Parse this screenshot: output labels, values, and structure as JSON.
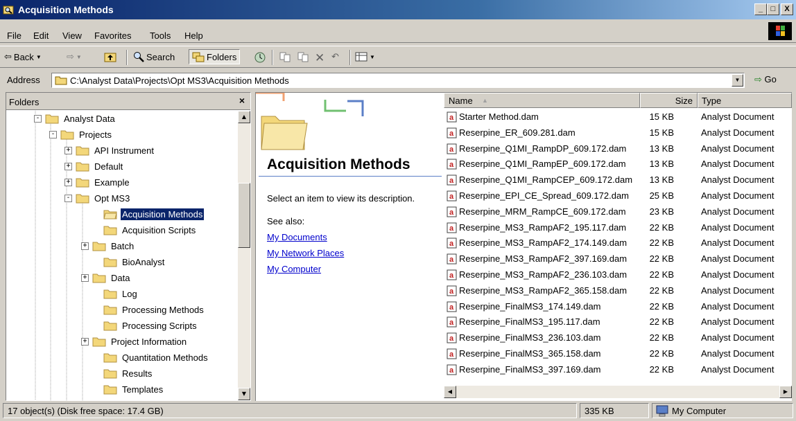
{
  "window": {
    "title": "Acquisition Methods",
    "min": "_",
    "max": "□",
    "close": "X"
  },
  "menu": [
    "File",
    "Edit",
    "View",
    "Favorites",
    "Tools",
    "Help"
  ],
  "toolbar": {
    "back": "Back",
    "search": "Search",
    "folders": "Folders"
  },
  "address": {
    "label": "Address",
    "value": "C:\\Analyst Data\\Projects\\Opt MS3\\Acquisition Methods",
    "go": "Go"
  },
  "folders_pane": {
    "title": "Folders",
    "close": "×",
    "items": [
      {
        "label": "Analyst Data",
        "exp": "-"
      },
      {
        "label": "Projects",
        "exp": "-"
      },
      {
        "label": "API Instrument",
        "exp": "+"
      },
      {
        "label": "Default",
        "exp": "+"
      },
      {
        "label": "Example",
        "exp": "+"
      },
      {
        "label": "Opt MS3",
        "exp": "-"
      },
      {
        "label": "Acquisition Methods",
        "exp": ""
      },
      {
        "label": "Acquisition Scripts",
        "exp": ""
      },
      {
        "label": "Batch",
        "exp": "+"
      },
      {
        "label": "BioAnalyst",
        "exp": ""
      },
      {
        "label": "Data",
        "exp": "+"
      },
      {
        "label": "Log",
        "exp": ""
      },
      {
        "label": "Processing Methods",
        "exp": ""
      },
      {
        "label": "Processing Scripts",
        "exp": ""
      },
      {
        "label": "Project Information",
        "exp": "+"
      },
      {
        "label": "Quantitation Methods",
        "exp": ""
      },
      {
        "label": "Results",
        "exp": ""
      },
      {
        "label": "Templates",
        "exp": ""
      }
    ]
  },
  "web_view": {
    "title": "Acquisition Methods",
    "description": "Select an item to view its description.",
    "see_also": "See also:",
    "links": [
      "My Documents",
      "My Network Places",
      "My Computer"
    ]
  },
  "file_list": {
    "columns": {
      "name": "Name",
      "size": "Size",
      "type": "Type"
    },
    "files": [
      {
        "name": "Starter Method.dam",
        "size": "15 KB",
        "type": "Analyst Document"
      },
      {
        "name": "Reserpine_ER_609.281.dam",
        "size": "15 KB",
        "type": "Analyst Document"
      },
      {
        "name": "Reserpine_Q1MI_RampDP_609.172.dam",
        "size": "13 KB",
        "type": "Analyst Document"
      },
      {
        "name": "Reserpine_Q1MI_RampEP_609.172.dam",
        "size": "13 KB",
        "type": "Analyst Document"
      },
      {
        "name": "Reserpine_Q1MI_RampCEP_609.172.dam",
        "size": "13 KB",
        "type": "Analyst Document"
      },
      {
        "name": "Reserpine_EPI_CE_Spread_609.172.dam",
        "size": "25 KB",
        "type": "Analyst Document"
      },
      {
        "name": "Reserpine_MRM_RampCE_609.172.dam",
        "size": "23 KB",
        "type": "Analyst Document"
      },
      {
        "name": "Reserpine_MS3_RampAF2_195.117.dam",
        "size": "22 KB",
        "type": "Analyst Document"
      },
      {
        "name": "Reserpine_MS3_RampAF2_174.149.dam",
        "size": "22 KB",
        "type": "Analyst Document"
      },
      {
        "name": "Reserpine_MS3_RampAF2_397.169.dam",
        "size": "22 KB",
        "type": "Analyst Document"
      },
      {
        "name": "Reserpine_MS3_RampAF2_236.103.dam",
        "size": "22 KB",
        "type": "Analyst Document"
      },
      {
        "name": "Reserpine_MS3_RampAF2_365.158.dam",
        "size": "22 KB",
        "type": "Analyst Document"
      },
      {
        "name": "Reserpine_FinalMS3_174.149.dam",
        "size": "22 KB",
        "type": "Analyst Document"
      },
      {
        "name": "Reserpine_FinalMS3_195.117.dam",
        "size": "22 KB",
        "type": "Analyst Document"
      },
      {
        "name": "Reserpine_FinalMS3_236.103.dam",
        "size": "22 KB",
        "type": "Analyst Document"
      },
      {
        "name": "Reserpine_FinalMS3_365.158.dam",
        "size": "22 KB",
        "type": "Analyst Document"
      },
      {
        "name": "Reserpine_FinalMS3_397.169.dam",
        "size": "22 KB",
        "type": "Analyst Document"
      }
    ]
  },
  "status": {
    "objects": "17 object(s) (Disk free space: 17.4 GB)",
    "size": "335 KB",
    "zone": "My Computer"
  },
  "colors": {
    "title_start": "#0a246a",
    "title_end": "#a6caf0",
    "folder": "#f3d77a",
    "selection": "#0a246a",
    "link": "#0000cc"
  }
}
